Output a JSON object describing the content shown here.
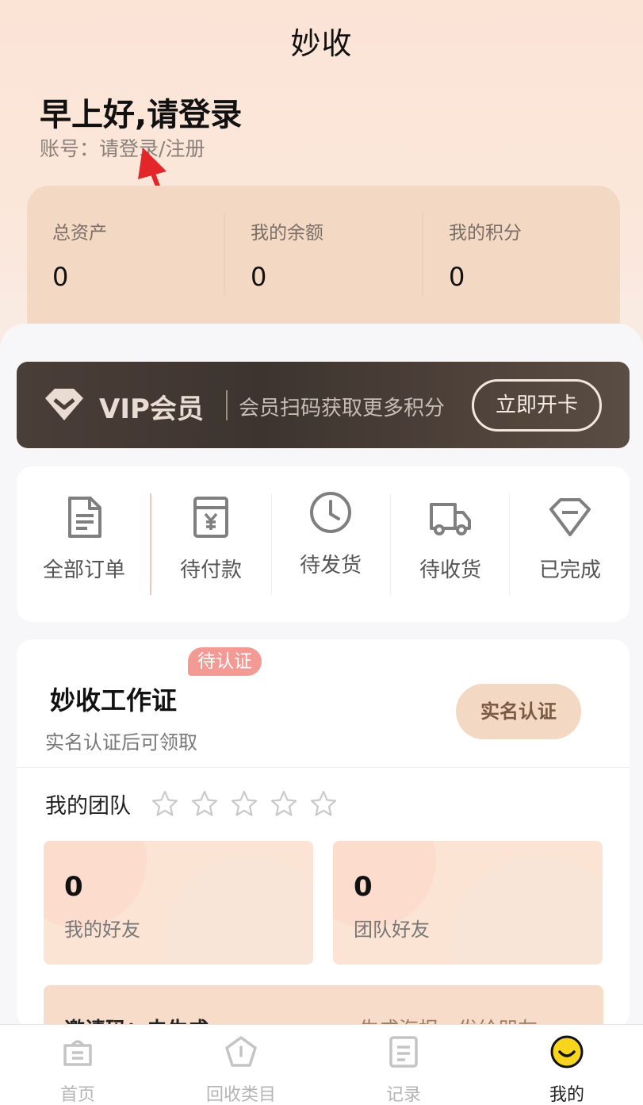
{
  "app": {
    "title": "妙收"
  },
  "header": {
    "greeting": "早上好,请登录",
    "account_prefix": "账号：",
    "account_link": "请登录/注册"
  },
  "assets": [
    {
      "label": "总资产",
      "value": "0"
    },
    {
      "label": "我的余额",
      "value": "0"
    },
    {
      "label": "我的积分",
      "value": "0"
    }
  ],
  "vip": {
    "title": "VIP会员",
    "desc": "会员扫码获取更多积分",
    "button": "立即开卡"
  },
  "orders": [
    {
      "label": "全部订单",
      "icon": "document-icon"
    },
    {
      "label": "待付款",
      "icon": "wallet-yen-icon"
    },
    {
      "label": "待发货",
      "icon": "clock-icon"
    },
    {
      "label": "待收货",
      "icon": "truck-icon"
    },
    {
      "label": "已完成",
      "icon": "diamond-icon"
    }
  ],
  "work_card": {
    "badge": "待认证",
    "title": "妙收工作证",
    "subtitle": "实名认证后可领取",
    "verify_button": "实名认证"
  },
  "team": {
    "title": "我的团队",
    "stars_filled": 0,
    "stars_total": 5,
    "my_friends": {
      "value": "0",
      "label": "我的好友"
    },
    "team_friends": {
      "value": "0",
      "label": "团队好友"
    }
  },
  "invite": {
    "code_label": "邀请码：未生成",
    "action": "生成海报，发给朋友 >"
  },
  "tabbar": [
    {
      "label": "首页",
      "icon": "home-bag-icon",
      "active": false
    },
    {
      "label": "回收类目",
      "icon": "pentagon-icon",
      "active": false
    },
    {
      "label": "记录",
      "icon": "record-icon",
      "active": false
    },
    {
      "label": "我的",
      "icon": "smiley-icon",
      "active": true
    }
  ],
  "colors": {
    "accent_peach": "#f3d8c4",
    "vip_dark": "#3e342f",
    "badge_red": "#f39a94",
    "smiley_yellow": "#f7d51d"
  }
}
